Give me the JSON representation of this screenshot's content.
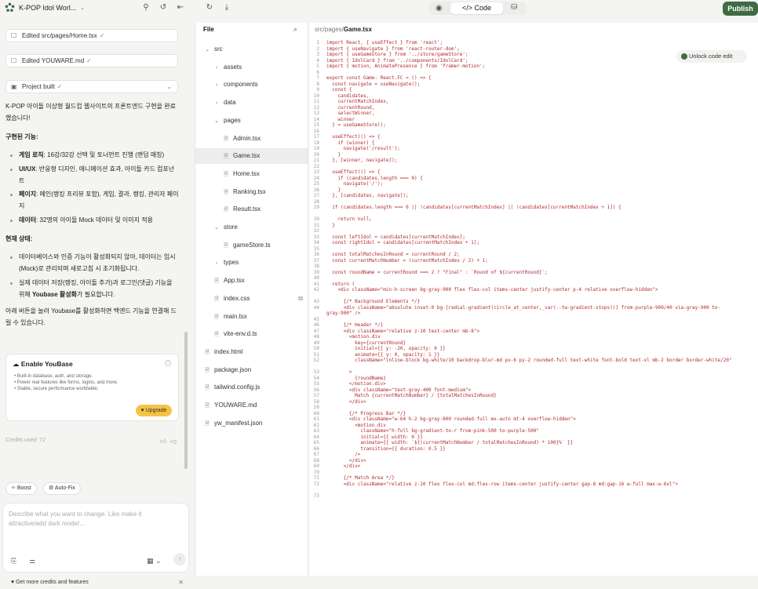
{
  "app": {
    "project_title": "K-POP Idol Worl...",
    "publish_label": "Publish",
    "tabs": {
      "code_label": "Code"
    }
  },
  "chat": {
    "cards": [
      {
        "label": "Edited src/pages/Home.tsx",
        "icon": "file-edit-icon"
      },
      {
        "label": "Edited YOUWARE.md",
        "icon": "file-edit-icon"
      },
      {
        "label": "Project built",
        "icon": "terminal-icon"
      }
    ],
    "intro": "K-POP 아이돌 이상형 월드컵 웹사이트의 프론트엔드 구현을 완료했습니다!",
    "features_heading": "구현된 기능:",
    "features": [
      {
        "bold": "게임 로직",
        "text": ": 16강/32강 선택 및 토너먼트 진행 (랜덤 매칭)"
      },
      {
        "bold": "UI/UX",
        "text": ": 반응형 디자인, 애니메이션 효과, 아이돌 카드 컴포넌트"
      },
      {
        "bold": "페이지",
        "text": ": 메인(랭킹 프리뷰 포함), 게임, 결과, 랭킹, 관리자 페이지"
      },
      {
        "bold": "데이터",
        "text": ": 32명의 아이돌 Mock 데이터 및 이미지 적용"
      }
    ],
    "status_heading": "현재 상태:",
    "status": [
      {
        "text": "데이터베이스와 인증 기능이 활성화되지 않아, 데이터는 임시(Mock)로 관리되며 새로고침 시 초기화됩니다."
      },
      {
        "text": "실제 데이터 저장(랭킹, 아이돌 추가)과 로그인(댓글) 기능을 위해 ",
        "bold": "Youbase 활성화",
        "tail": "가 필요합니다."
      }
    ],
    "outro": "아래 버튼을 눌러 Youbase를 활성화하면 백엔드 기능을 연결해 드릴 수 있습니다.",
    "youbase": {
      "title": "Enable YouBase",
      "bullets": [
        "Built-in database, auth, and storage.",
        "Power real features like forms, logins, and more.",
        "Stable, secure performance worldwide."
      ],
      "upgrade": "Upgrade"
    },
    "credits_used": "Credits used: 72",
    "boost_label": "Boost",
    "autofix_label": "Auto-Fix",
    "input_placeholder": "Describe what you want to change. Like make it attractive/add dark mode/...",
    "more_credits": "Get more credits and features"
  },
  "files": {
    "header": "File",
    "tree": [
      {
        "label": "src",
        "type": "folder-open",
        "depth": 0
      },
      {
        "label": "assets",
        "type": "folder",
        "depth": 1
      },
      {
        "label": "components",
        "type": "folder",
        "depth": 1
      },
      {
        "label": "data",
        "type": "folder",
        "depth": 1
      },
      {
        "label": "pages",
        "type": "folder-open",
        "depth": 1
      },
      {
        "label": "Admin.tsx",
        "type": "file",
        "depth": 2
      },
      {
        "label": "Game.tsx",
        "type": "file",
        "depth": 2,
        "selected": true
      },
      {
        "label": "Home.tsx",
        "type": "file",
        "depth": 2
      },
      {
        "label": "Ranking.tsx",
        "type": "file",
        "depth": 2
      },
      {
        "label": "Result.tsx",
        "type": "file",
        "depth": 2
      },
      {
        "label": "store",
        "type": "folder-open",
        "depth": 1
      },
      {
        "label": "gameStore.ts",
        "type": "file",
        "depth": 2
      },
      {
        "label": "types",
        "type": "folder",
        "depth": 1
      },
      {
        "label": "App.tsx",
        "type": "file",
        "depth": 1
      },
      {
        "label": "index.css",
        "type": "file",
        "depth": 1,
        "external": true
      },
      {
        "label": "main.tsx",
        "type": "file",
        "depth": 1
      },
      {
        "label": "vite-env.d.ts",
        "type": "file",
        "depth": 1
      },
      {
        "label": "index.html",
        "type": "file",
        "depth": 0
      },
      {
        "label": "package.json",
        "type": "file",
        "depth": 0
      },
      {
        "label": "tailwind.config.js",
        "type": "file",
        "depth": 0
      },
      {
        "label": "YOUWARE.md",
        "type": "file",
        "depth": 0
      },
      {
        "label": "yw_manifest.json",
        "type": "file",
        "depth": 0
      }
    ]
  },
  "editor": {
    "path_prefix": "src/pages/",
    "path_file": "Game.tsx",
    "unlock_label": "Unlock code edit",
    "lines": [
      "import React, { useEffect } from 'react';",
      "import { useNavigate } from 'react-router-dom';",
      "import { useGameStore } from '../store/gameStore';",
      "import { IdolCard } from '../components/IdolCard';",
      "import { motion, AnimatePresence } from 'framer-motion';",
      "",
      "export const Game: React.FC = () => {",
      "  const navigate = useNavigate();",
      "  const {",
      "    candidates,",
      "    currentMatchIndex,",
      "    currentRound,",
      "    selectWinner,",
      "    winner",
      "  } = useGameStore();",
      "",
      "  useEffect(() => {",
      "    if (winner) {",
      "      navigate('/result');",
      "    }",
      "  }, [winner, navigate]);",
      "",
      "  useEffect(() => {",
      "    if (candidates.length === 0) {",
      "      navigate('/');",
      "    }",
      "  }, [candidates, navigate]);",
      "",
      "  if (candidates.length === 0 || !candidates[currentMatchIndex] || !candidates[currentMatchIndex + 1]) {",
      "    return null;",
      "  }",
      "",
      "  const leftIdol = candidates[currentMatchIndex];",
      "  const rightIdol = candidates[currentMatchIndex + 1];",
      "",
      "  const totalMatchesInRound = currentRound / 2;",
      "  const currentMatchNumber = (currentMatchIndex / 2) + 1;",
      "",
      "  const roundName = currentRound === 2 ? \"Final\" : `Round of ${currentRound}`;",
      "",
      "  return (",
      "    <div className=\"min-h-screen bg-gray-900 flex flex-col items-center justify-center p-4 relative overflow-hidden\">",
      "      {/* Background Elements */}",
      "      <div className=\"absolute inset-0 bg-[radial-gradient(circle_at_center,_var(--tw-gradient-stops))] from-purple-900/40 via-gray-900 to-gray-900\" />",
      "",
      "      {/* Header */}",
      "      <div className=\"relative z-10 text-center mb-8\">",
      "        <motion.div",
      "          key={currentRound}",
      "          initial={{ y: -20, opacity: 0 }}",
      "          animate={{ y: 0, opacity: 1 }}",
      "          className=\"inline-block bg-white/10 backdrop-blur-md px-6 py-2 rounded-full text-white font-bold text-xl mb-2 border border-white/20\"",
      "        >",
      "          {roundName}",
      "        </motion.div>",
      "        <div className=\"text-gray-400 font-medium\">",
      "          Match {currentMatchNumber} / {totalMatchesInRound}",
      "        </div>",
      "",
      "        {/* Progress Bar */}",
      "        <div className=\"w-64 h-2 bg-gray-800 rounded-full mx-auto mt-4 overflow-hidden\">",
      "          <motion.div",
      "            className=\"h-full bg-gradient-to-r from-pink-500 to-purple-500\"",
      "            initial={{ width: 0 }}",
      "            animate={{ width: `${(currentMatchNumber / totalMatchesInRound) * 100}%` }}",
      "            transition={{ duration: 0.5 }}",
      "          />",
      "        </div>",
      "      </div>",
      "",
      "      {/* Match Area */}",
      "      <div className=\"relative z-10 flex flex-col md:flex-row items-center justify-center gap-8 md:gap-16 w-full max-w-6xl\">",
      ""
    ]
  }
}
